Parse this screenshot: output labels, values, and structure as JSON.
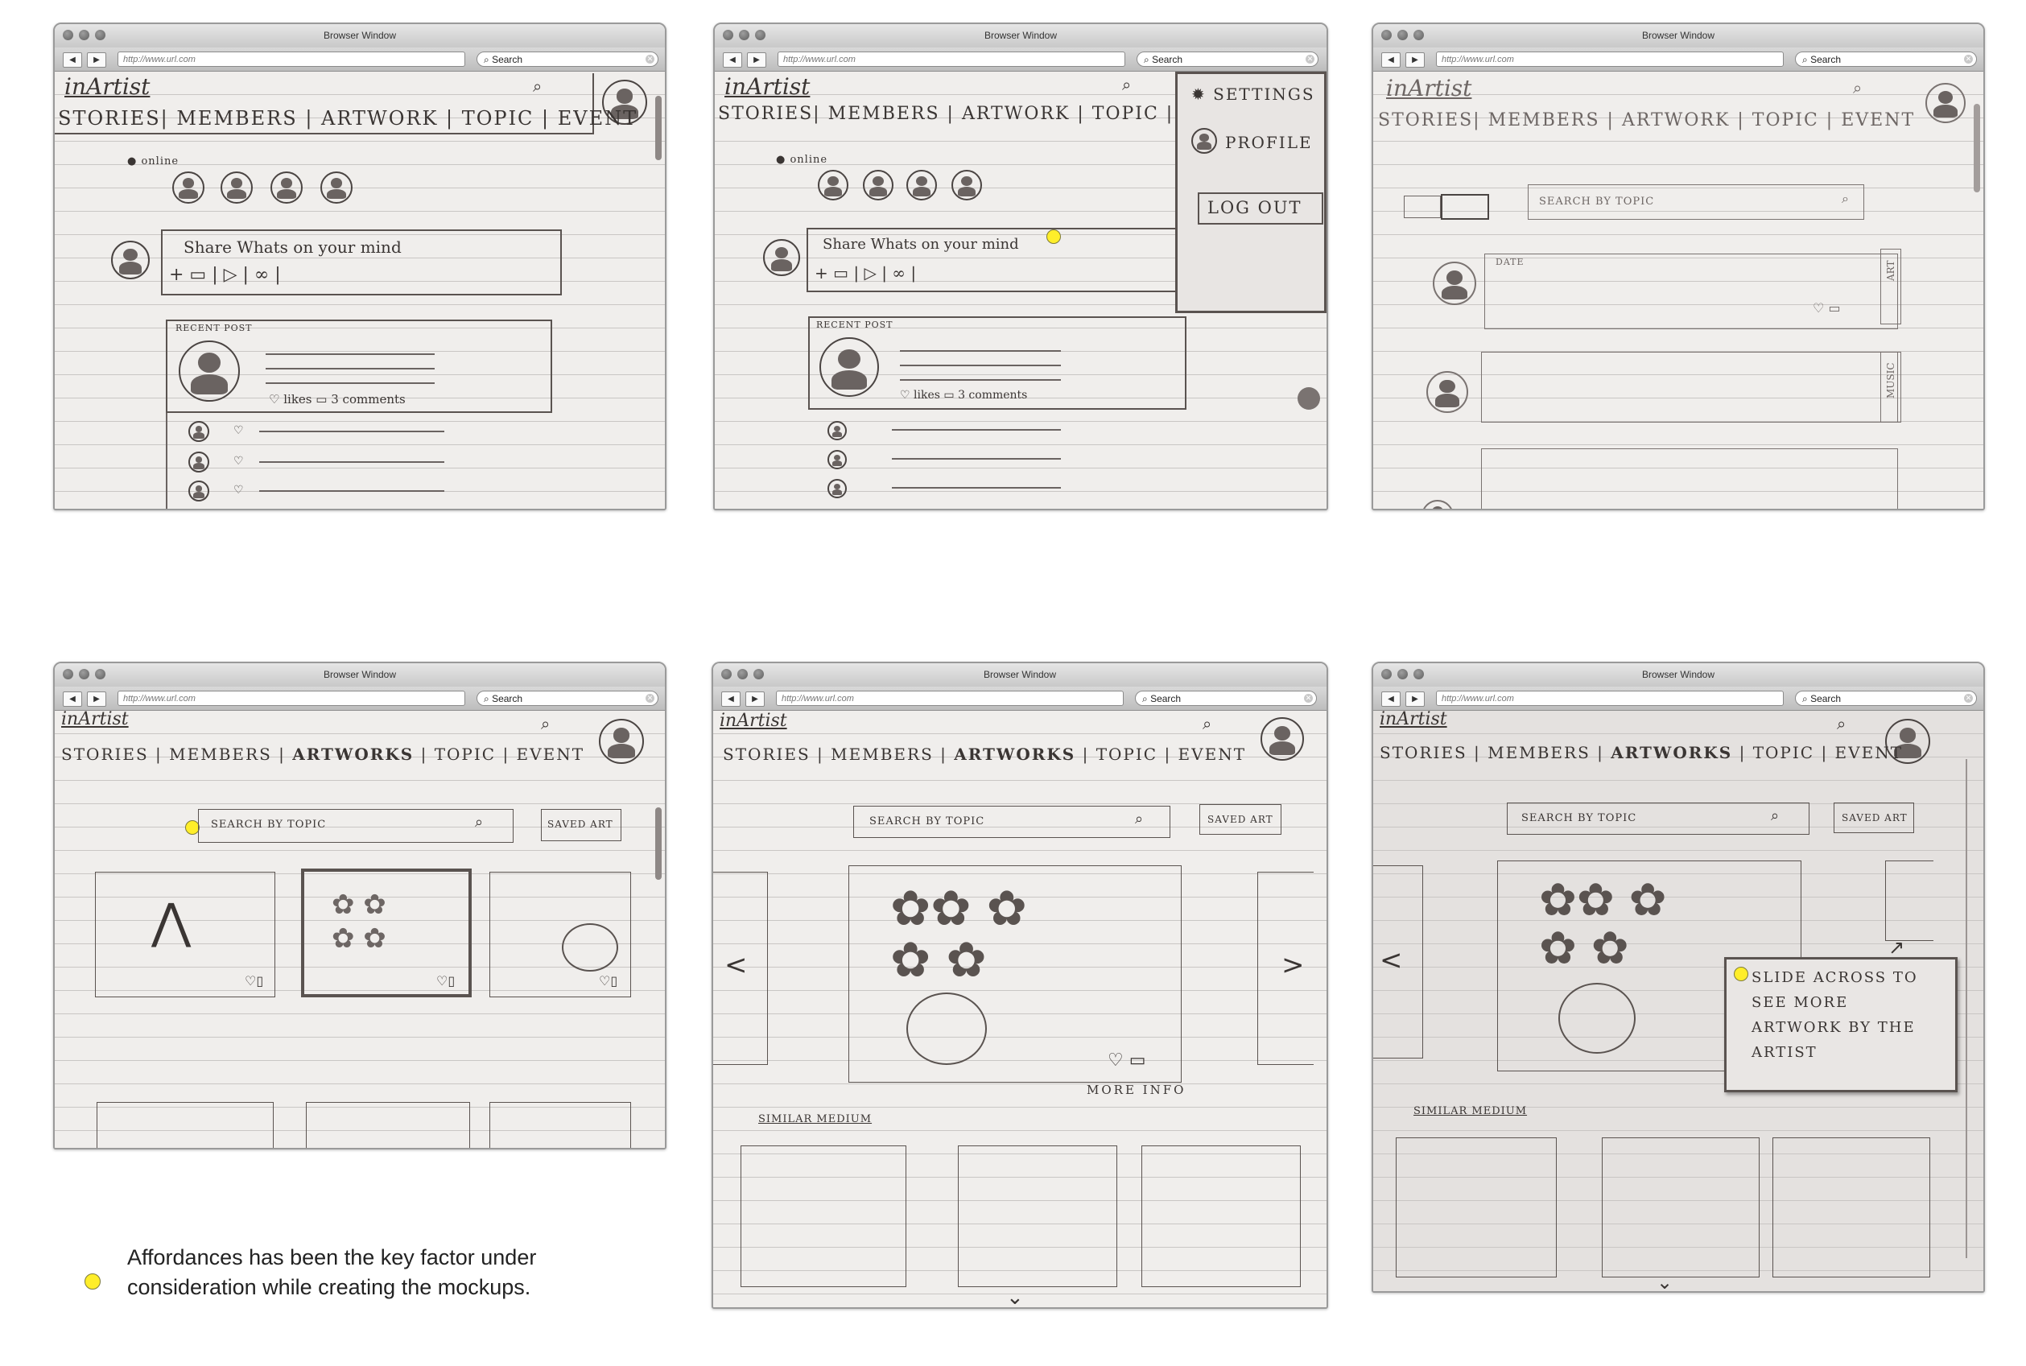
{
  "browser": {
    "window_title": "Browser Window",
    "url": "http://www.url.com",
    "search_label": "Search",
    "back_glyph": "◀",
    "forward_glyph": "▶"
  },
  "app": {
    "logo": "inArtist",
    "nav_stories_events": [
      "STORIES",
      "MEMBERS",
      "ARTWORK",
      "TOPIC",
      "EVENT"
    ],
    "nav_artworks": [
      "STORIES",
      "MEMBERS",
      "ARTWORKS",
      "TOPIC",
      "EVENT"
    ]
  },
  "feed": {
    "online_label": "online",
    "share_placeholder": "Share Whats on your mind",
    "recent_post_label": "RECENT POST",
    "likes_label": "likes",
    "comments_label": "3 comments"
  },
  "menu": {
    "settings": "SETTINGS",
    "profile": "PROFILE",
    "logout": "LOG OUT"
  },
  "topics": {
    "search_placeholder": "SEARCH BY TOPIC",
    "date_label": "DATE",
    "tag_art": "ART",
    "tag_music": "MUSIC"
  },
  "artworks": {
    "search_placeholder": "SEARCH BY TOPIC",
    "saved_button": "SAVED ART",
    "more_info": "MORE INFO",
    "similar_medium": "SIMILAR MEDIUM",
    "tooltip": "SLIDE ACROSS TO SEE MORE ARTWORK BY THE ARTIST",
    "prev_glyph": "<",
    "next_glyph": ">",
    "down_glyph": "⌄"
  },
  "legend": {
    "caption": "Affordances  has been the key factor under consideration while creating the mockups.",
    "dot_color": "#ffee2a"
  }
}
